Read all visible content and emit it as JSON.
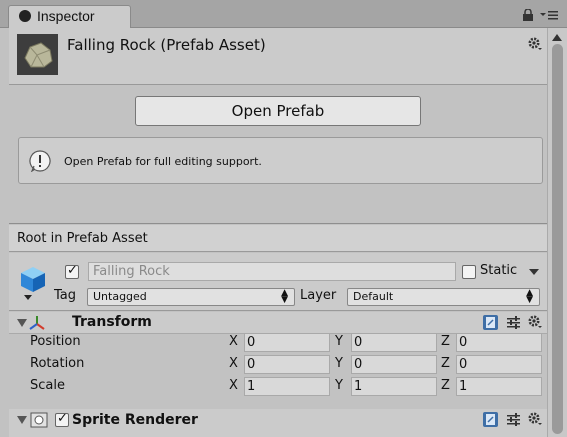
{
  "tab": {
    "title": "Inspector"
  },
  "header": {
    "title": "Falling Rock (Prefab Asset)"
  },
  "open_prefab": {
    "button_label": "Open Prefab",
    "help_text": "Open Prefab for full editing support."
  },
  "root": {
    "label": "Root in Prefab Asset"
  },
  "gameobject": {
    "active": true,
    "name": "Falling Rock",
    "static_label": "Static",
    "static": false,
    "tag_label": "Tag",
    "tag_value": "Untagged",
    "layer_label": "Layer",
    "layer_value": "Default"
  },
  "transform": {
    "title": "Transform",
    "rows": [
      {
        "label": "Position",
        "x": "0",
        "y": "0",
        "z": "0"
      },
      {
        "label": "Rotation",
        "x": "0",
        "y": "0",
        "z": "0"
      },
      {
        "label": "Scale",
        "x": "1",
        "y": "1",
        "z": "1"
      }
    ],
    "axis_x": "X",
    "axis_y": "Y",
    "axis_z": "Z"
  },
  "sprite_renderer": {
    "title": "Sprite Renderer",
    "enabled": true
  },
  "colors": {
    "accent_help": "#3e6ea6",
    "panel": "#c2c2c2",
    "header": "#cbcbcb"
  }
}
